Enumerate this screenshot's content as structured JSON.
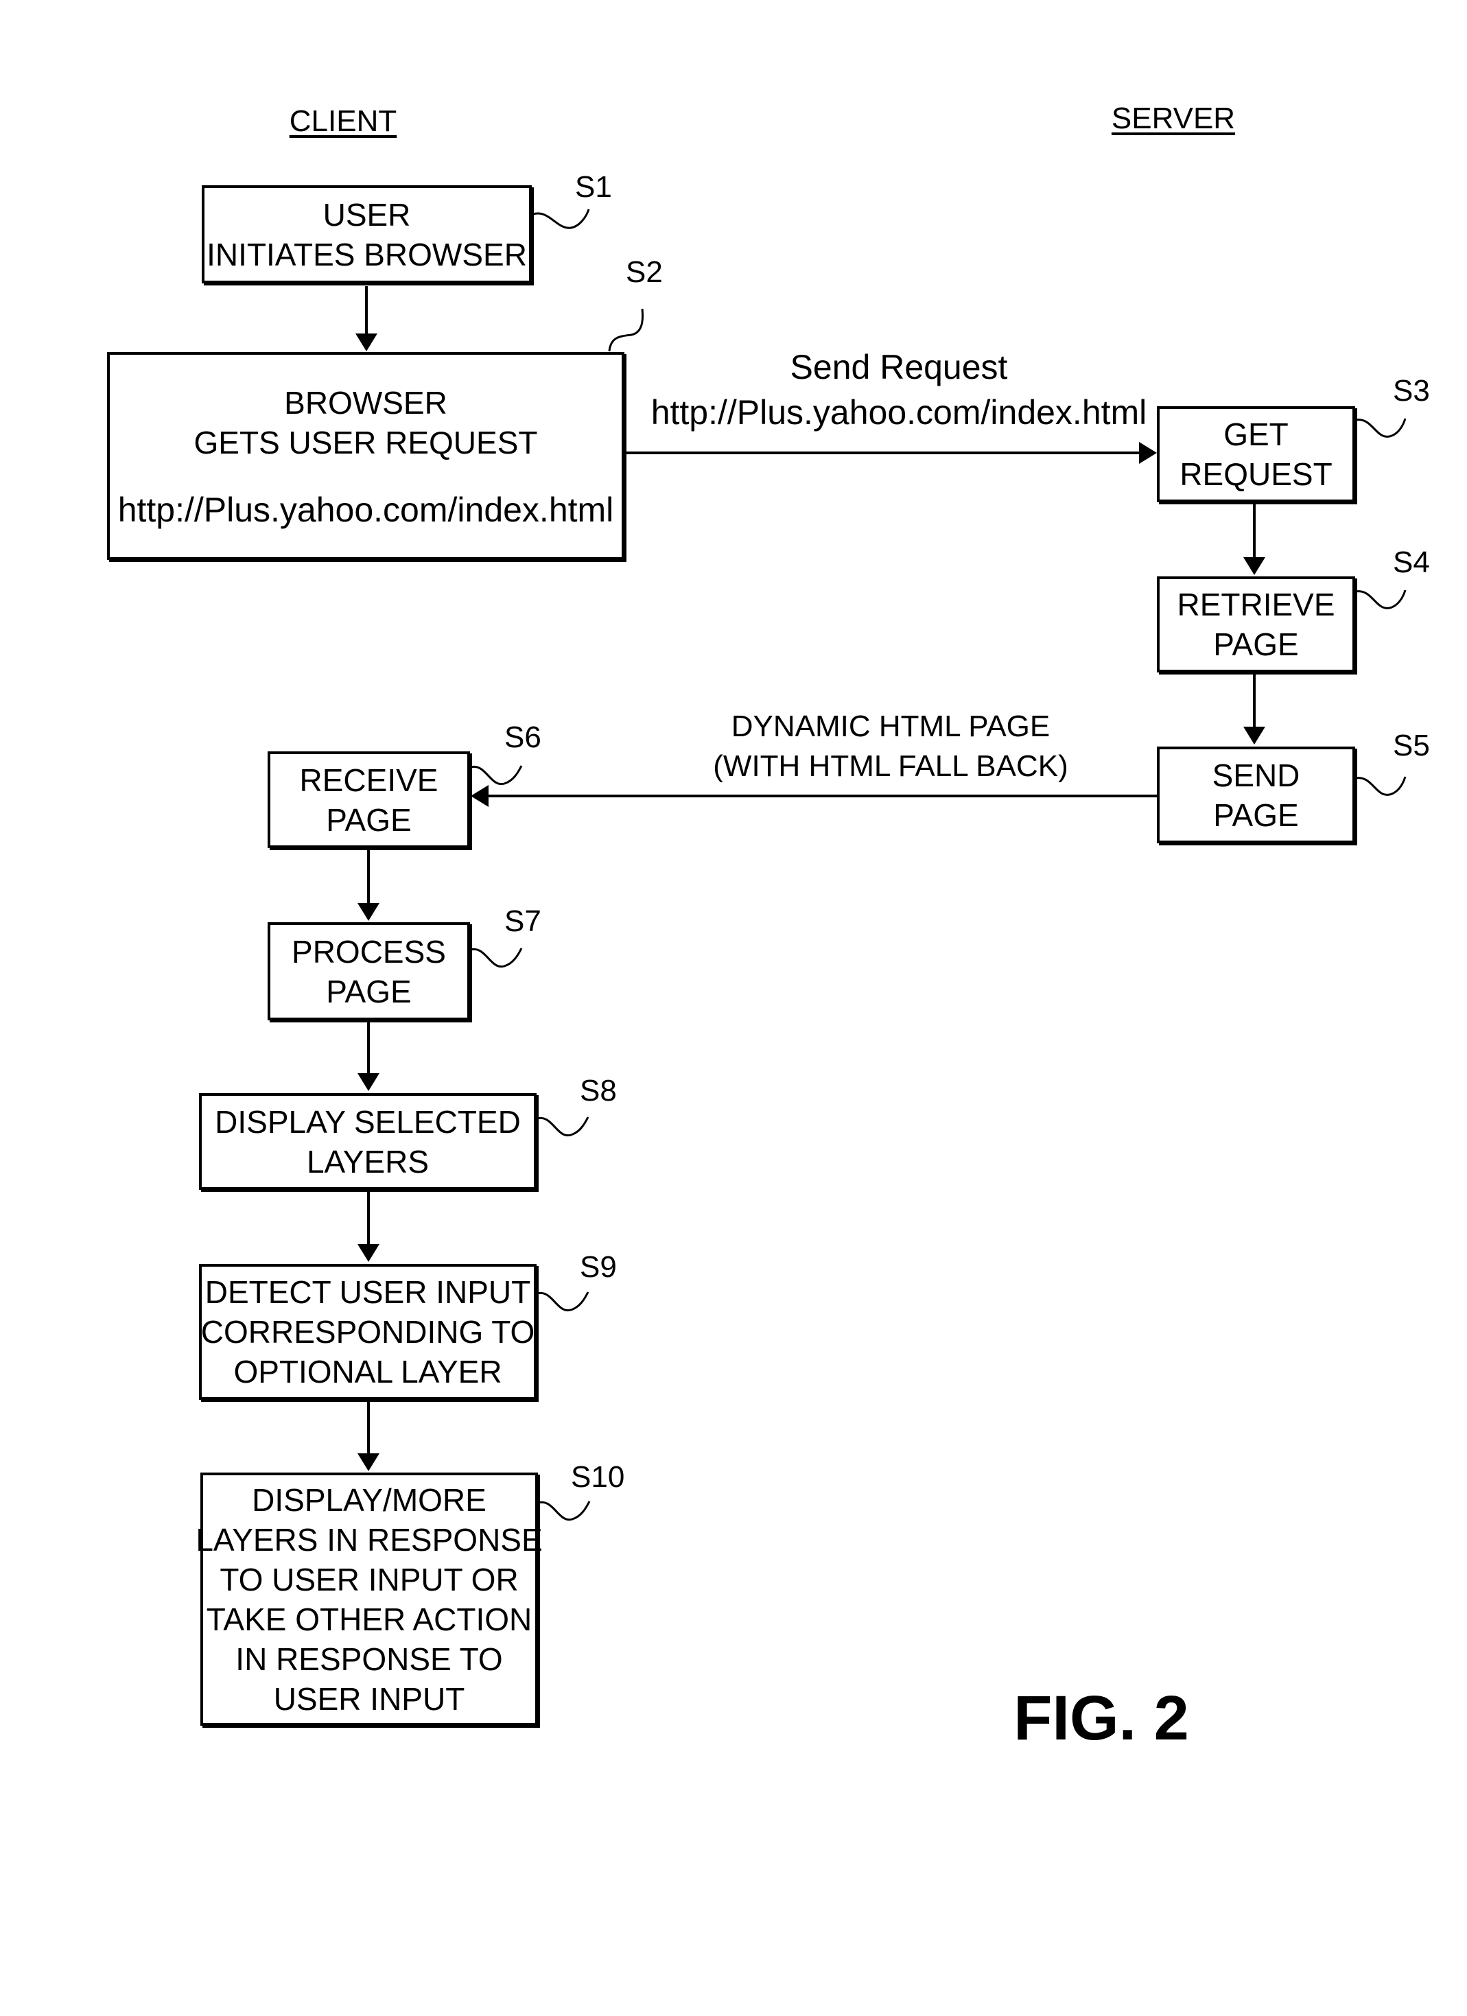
{
  "headers": {
    "client": "CLIENT",
    "server": "SERVER"
  },
  "steps": [
    {
      "id": "S1",
      "label": "S1",
      "lines": [
        "USER",
        "INITIATES BROWSER"
      ]
    },
    {
      "id": "S2",
      "label": "S2",
      "lines": [
        "BROWSER",
        "GETS USER REQUEST"
      ],
      "url": "http://Plus.yahoo.com/index.html"
    },
    {
      "id": "S3",
      "label": "S3",
      "lines": [
        "GET",
        "REQUEST"
      ]
    },
    {
      "id": "S4",
      "label": "S4",
      "lines": [
        "RETRIEVE",
        "PAGE"
      ]
    },
    {
      "id": "S5",
      "label": "S5",
      "lines": [
        "SEND",
        "PAGE"
      ]
    },
    {
      "id": "S6",
      "label": "S6",
      "lines": [
        "RECEIVE",
        "PAGE"
      ]
    },
    {
      "id": "S7",
      "label": "S7",
      "lines": [
        "PROCESS",
        "PAGE"
      ]
    },
    {
      "id": "S8",
      "label": "S8",
      "lines": [
        "DISPLAY SELECTED",
        "LAYERS"
      ]
    },
    {
      "id": "S9",
      "label": "S9",
      "lines": [
        "DETECT USER INPUT",
        "CORRESPONDING TO",
        "OPTIONAL LAYER"
      ]
    },
    {
      "id": "S10",
      "label": "S10",
      "lines": [
        "DISPLAY/MORE",
        "LAYERS IN RESPONSE",
        "TO USER INPUT OR",
        "TAKE OTHER ACTION",
        "IN RESPONSE TO",
        "USER INPUT"
      ]
    }
  ],
  "edges": {
    "request": {
      "title": "Send Request",
      "url": "http://Plus.yahoo.com/index.html"
    },
    "response": {
      "line1": "DYNAMIC HTML PAGE",
      "line2": "(WITH HTML FALL BACK)"
    }
  },
  "figure_label": "FIG. 2"
}
